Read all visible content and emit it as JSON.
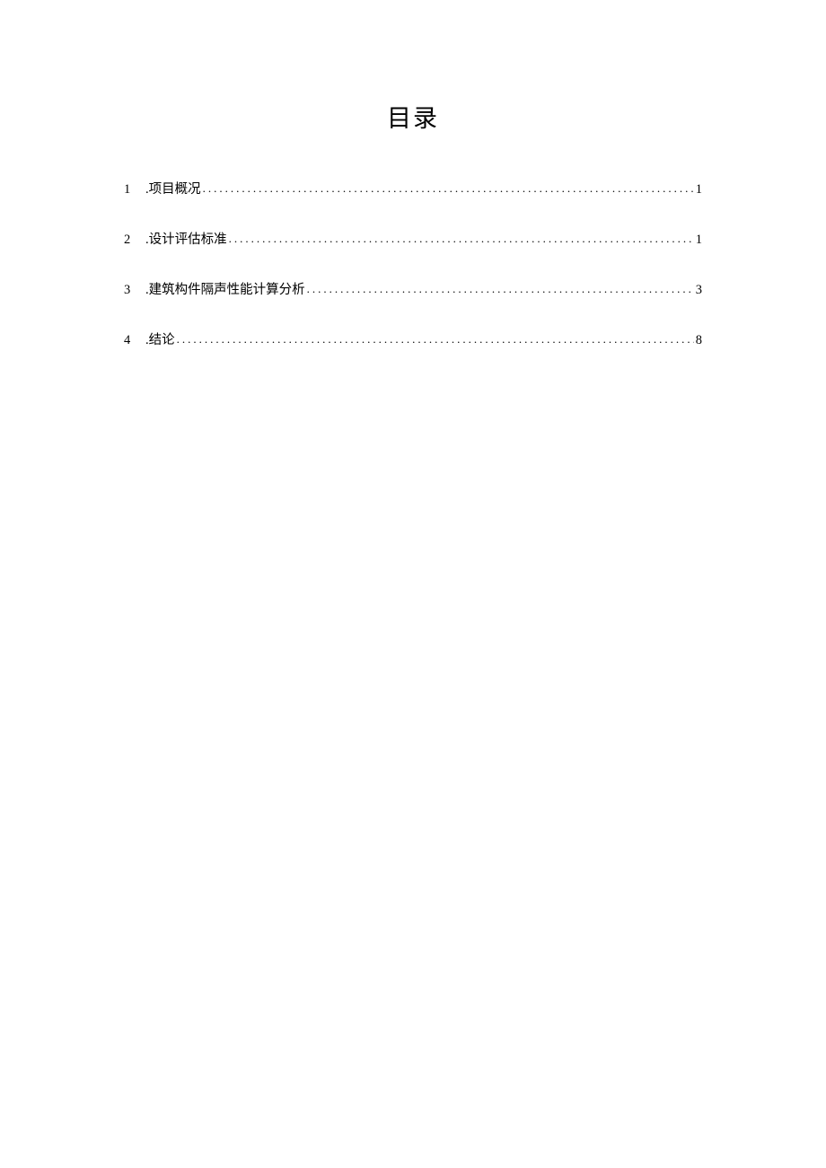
{
  "title": "目录",
  "toc": {
    "entries": [
      {
        "num": "1",
        "prefix": ".",
        "label": "项目概况",
        "page": "1"
      },
      {
        "num": "2",
        "prefix": ".",
        "label": "设计评估标准",
        "page": "1"
      },
      {
        "num": "3",
        "prefix": ".",
        "label": "建筑构件隔声性能计算分析",
        "page": "3"
      },
      {
        "num": "4",
        "prefix": ".",
        "label": "结论",
        "page": "8"
      }
    ]
  }
}
